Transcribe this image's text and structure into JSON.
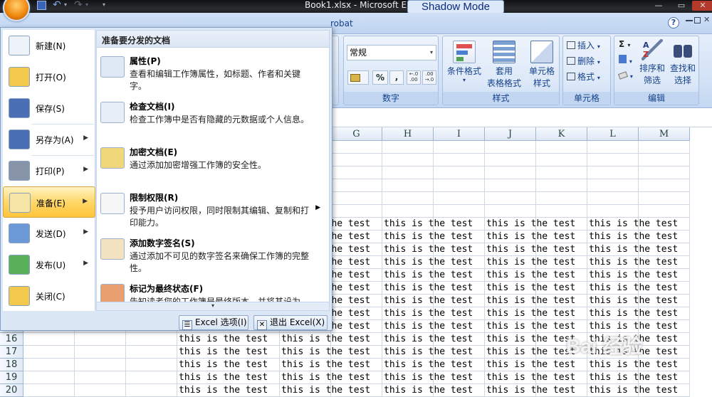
{
  "window": {
    "title": "Book1.xlsx - Microsoft E",
    "overlay_label": "Shadow Mode"
  },
  "tabs": {
    "partial": "robat",
    "help": "?"
  },
  "ribbon": {
    "number_format": "常规",
    "groups": {
      "number": "数字",
      "styles": "样式",
      "cells": "单元格",
      "editing": "编辑"
    },
    "buttons": {
      "conditional_format": "条件格式",
      "table_format_l1": "套用",
      "table_format_l2": "表格格式",
      "cell_style_l1": "单元格",
      "cell_style_l2": "样式",
      "insert": "插入",
      "delete": "删除",
      "format": "格式",
      "sort_filter_l1": "排序和",
      "sort_filter_l2": "筛选",
      "find_select_l1": "查找和",
      "find_select_l2": "选择",
      "sum_symbol": "Σ",
      "percent": "%",
      "comma": ",",
      "inc_dec": "+.0\n.00",
      "dec_dec": ".00\n→.0"
    }
  },
  "grid": {
    "columns": [
      "G",
      "H",
      "I",
      "J",
      "K",
      "L",
      "M"
    ],
    "visible_rows": [
      "16",
      "17",
      "18",
      "19",
      "20"
    ],
    "cell_text": "this is the test"
  },
  "menu": {
    "left_items": [
      {
        "label": "新建(N)",
        "icon": "new-document-icon",
        "arrow": false
      },
      {
        "label": "打开(O)",
        "icon": "open-folder-icon",
        "arrow": false
      },
      {
        "label": "保存(S)",
        "icon": "save-disk-icon",
        "arrow": false
      },
      {
        "label": "另存为(A)",
        "icon": "save-as-icon",
        "arrow": true
      },
      {
        "label": "打印(P)",
        "icon": "printer-icon",
        "arrow": true
      },
      {
        "label": "准备(E)",
        "icon": "prepare-pencil-icon",
        "arrow": true
      },
      {
        "label": "发送(D)",
        "icon": "send-icon",
        "arrow": true
      },
      {
        "label": "发布(U)",
        "icon": "publish-icon",
        "arrow": true
      },
      {
        "label": "关闭(C)",
        "icon": "close-folder-icon",
        "arrow": false
      }
    ],
    "right_title": "准备要分发的文档",
    "sub_items": [
      {
        "title": "属性(P)",
        "desc": "查看和编辑工作簿属性，如标题、作者和关键字。",
        "icon": "properties-icon"
      },
      {
        "title": "检查文档(I)",
        "desc": "检查工作簿中是否有隐藏的元数据或个人信息。",
        "icon": "inspect-document-icon"
      },
      {
        "title": "加密文档(E)",
        "desc": "通过添加加密增强工作簿的安全性。",
        "icon": "encrypt-lock-icon"
      },
      {
        "title": "限制权限(R)",
        "desc": "授予用户访问权限，同时限制其编辑、复制和打印能力。",
        "icon": "restrict-permission-icon"
      },
      {
        "title": "添加数字签名(S)",
        "desc": "通过添加不可见的数字签名来确保工作簿的完整性。",
        "icon": "digital-signature-icon"
      },
      {
        "title": "标记为最终状态(F)",
        "desc": "告知读者您的工作簿是最终版本，并将其设为",
        "icon": "mark-final-icon"
      }
    ],
    "options_button": "Excel 选项(I)",
    "exit_button": "退出 Excel(X)"
  },
  "watermark": "Bai 经验"
}
